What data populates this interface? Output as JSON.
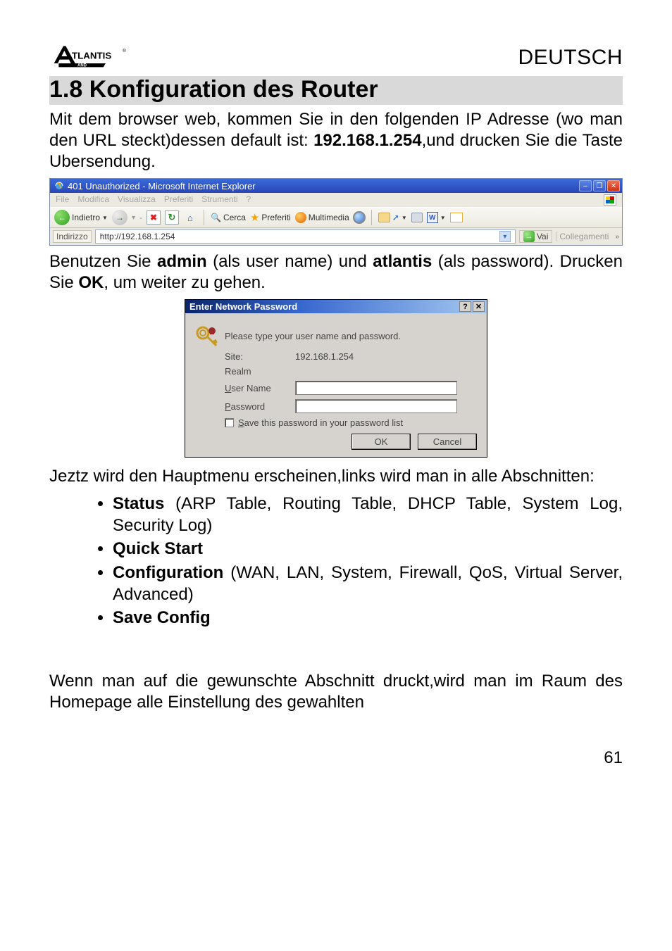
{
  "header": {
    "logo_main": "TLANTIS",
    "logo_reg": "®",
    "logo_sub": "AND",
    "language": "DEUTSCH"
  },
  "section_title": "1.8 Konfiguration des Router",
  "intro_1": "Mit dem browser web, kommen Sie in den folgenden IP Adresse (wo man den URL steckt)dessen default ist: ",
  "intro_ip": "192.168.1.254",
  "intro_2": ",und drucken Sie die Taste Ubersendung.",
  "ie": {
    "title": "401 Unauthorized - Microsoft Internet Explorer",
    "menus": [
      "File",
      "Modifica",
      "Visualizza",
      "Preferiti",
      "Strumenti",
      "?"
    ],
    "back": "Indietro",
    "search": "Cerca",
    "fav": "Preferiti",
    "media": "Multimedia",
    "addr_label": "Indirizzo",
    "addr_value": "http://192.168.1.254",
    "go": "Vai",
    "links": "Collegamenti"
  },
  "mid_1a": "Benutzen Sie ",
  "mid_user": "admin",
  "mid_1b": " (als user name) und ",
  "mid_pass": "atlantis",
  "mid_1c": " (als password). Drucken Sie ",
  "mid_ok": "OK",
  "mid_1d": ", um weiter zu gehen.",
  "pw": {
    "title": "Enter Network Password",
    "prompt": "Please type your user name and password.",
    "site_label": "Site:",
    "site_value": "192.168.1.254",
    "realm_label": "Realm",
    "user_label_pre": "U",
    "user_label_post": "ser Name",
    "pass_label_pre": "P",
    "pass_label_post": "assword",
    "save_pre": "S",
    "save_post": "ave this password in your password list",
    "ok": "OK",
    "cancel": "Cancel"
  },
  "menu_intro": "Jeztz wird den Hauptmenu erscheinen,links wird man in alle Abschnitten:",
  "bullets": {
    "status_label": "Status",
    "status_rest": " (ARP Table, Routing Table, DHCP Table, System Log, Security Log)",
    "quick": "Quick Start",
    "conf_label": "Configuration",
    "conf_rest": " (WAN, LAN, System, Firewall, QoS, Virtual Server, Advanced)",
    "save": "Save Config"
  },
  "bottom": "Wenn man auf die gewunschte Abschnitt druckt,wird man im Raum des Homepage alle Einstellung des gewahlten",
  "page_number": "61"
}
